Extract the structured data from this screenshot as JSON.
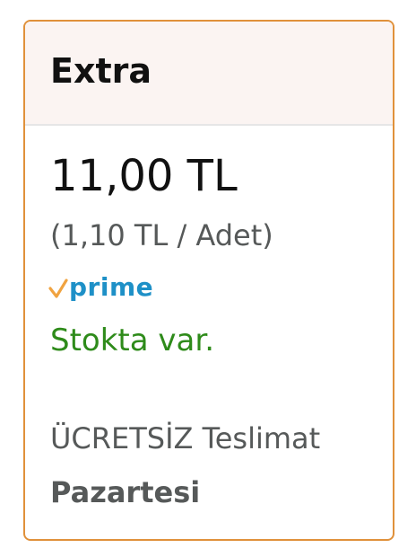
{
  "offer": {
    "title": "Extra",
    "price": "11,00 TL",
    "unit_price": "(1,10 TL / Adet)",
    "badge_text": "prime",
    "badge_icon": "check-icon",
    "stock_status": "Stokta var.",
    "delivery_label": "ÜCRETSİZ Teslimat",
    "delivery_day": "Pazartesi"
  },
  "colors": {
    "border": "#e0913b",
    "header_bg": "#fbf4f2",
    "prime": "#1e90c7",
    "prime_check": "#f0a340",
    "stock": "#2e8b1a",
    "secondary_text": "#565959"
  }
}
